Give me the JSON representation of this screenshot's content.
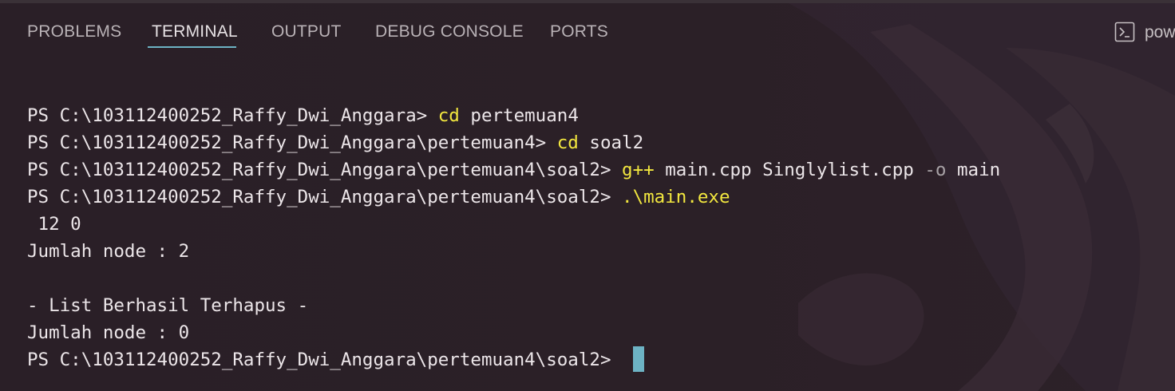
{
  "panel": {
    "tabs": [
      {
        "label": "PROBLEMS"
      },
      {
        "label": "TERMINAL",
        "active": true
      },
      {
        "label": "OUTPUT"
      },
      {
        "label": "DEBUG CONSOLE"
      },
      {
        "label": "PORTS"
      }
    ],
    "shell": {
      "label": "pow",
      "icon": "terminal-icon"
    }
  },
  "terminal": {
    "line1": {
      "prompt": "PS C:\\103112400252_Raffy_Dwi_Anggara> ",
      "cmd": "cd",
      "args": " pertemuan4"
    },
    "line2": {
      "prompt": "PS C:\\103112400252_Raffy_Dwi_Anggara\\pertemuan4> ",
      "cmd": "cd",
      "args": " soal2"
    },
    "line3": {
      "prompt": "PS C:\\103112400252_Raffy_Dwi_Anggara\\pertemuan4\\soal2> ",
      "cmd": "g++",
      "args": " main.cpp Singlylist.cpp ",
      "flag": "-o",
      "args2": " main"
    },
    "line4": {
      "prompt": "PS C:\\103112400252_Raffy_Dwi_Anggara\\pertemuan4\\soal2> ",
      "cmd": ".\\main.exe"
    },
    "output": [
      " 12 0",
      "Jumlah node : 2",
      "",
      "- List Berhasil Terhapus -",
      "Jumlah node : 0"
    ],
    "final_prompt": "PS C:\\103112400252_Raffy_Dwi_Anggara\\pertemuan4\\soal2> "
  },
  "colors": {
    "background": "#2a1f27",
    "command": "#f2e73f",
    "cursor": "#6db3c4",
    "active_tab_underline": "#6db3c4"
  }
}
